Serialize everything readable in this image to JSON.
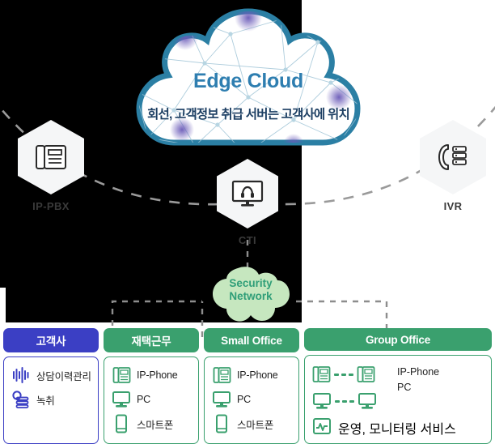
{
  "diagram": {
    "edge_cloud": {
      "title": "Edge Cloud",
      "subtitle": "회선, 고객정보 취급 서버는 고객사에 위치",
      "title_color": "#2e7eb0",
      "subtitle_color": "#1d3f63",
      "outline_color": "#2b7fa4"
    },
    "security_cloud": {
      "line1": "Security",
      "line2": "Network",
      "text_color": "#2f9e78",
      "fill_color": "#c6e7bf"
    },
    "nodes": [
      {
        "id": "ip-pbx",
        "label": "IP-PBX",
        "icon": "ip-phone-icon"
      },
      {
        "id": "cti",
        "label": "CTI",
        "icon": "headset-monitor-icon"
      },
      {
        "id": "ivr",
        "label": "IVR",
        "icon": "handset-server-icon"
      }
    ],
    "columns": [
      {
        "id": "customer",
        "header": "고객사",
        "accent": "#3b3fc4",
        "items": [
          {
            "icon": "waveform-icon",
            "label": "상담이력관리"
          },
          {
            "icon": "recording-icon",
            "label": "녹취"
          }
        ]
      },
      {
        "id": "remote-work",
        "header": "재택근무",
        "accent": "#3aa06e",
        "items": [
          {
            "icon": "ip-phone-icon",
            "label": "IP-Phone"
          },
          {
            "icon": "desktop-icon",
            "label": "PC"
          },
          {
            "icon": "smartphone-icon",
            "label": "스마트폰"
          }
        ]
      },
      {
        "id": "small-office",
        "header": "Small Office",
        "accent": "#3aa06e",
        "items": [
          {
            "icon": "ip-phone-icon",
            "label": "IP-Phone"
          },
          {
            "icon": "desktop-icon",
            "label": "PC"
          },
          {
            "icon": "smartphone-icon",
            "label": "스마트폰"
          }
        ]
      },
      {
        "id": "group-office",
        "header": "Group Office",
        "accent": "#3aa06e",
        "items": [
          {
            "icon": "ip-phone-pair-icon",
            "label": "IP-Phone"
          },
          {
            "icon": "desktop-pair-icon",
            "label": "PC"
          },
          {
            "icon": "monitoring-icon",
            "label": "운영, 모니터링 서비스"
          }
        ]
      }
    ]
  }
}
